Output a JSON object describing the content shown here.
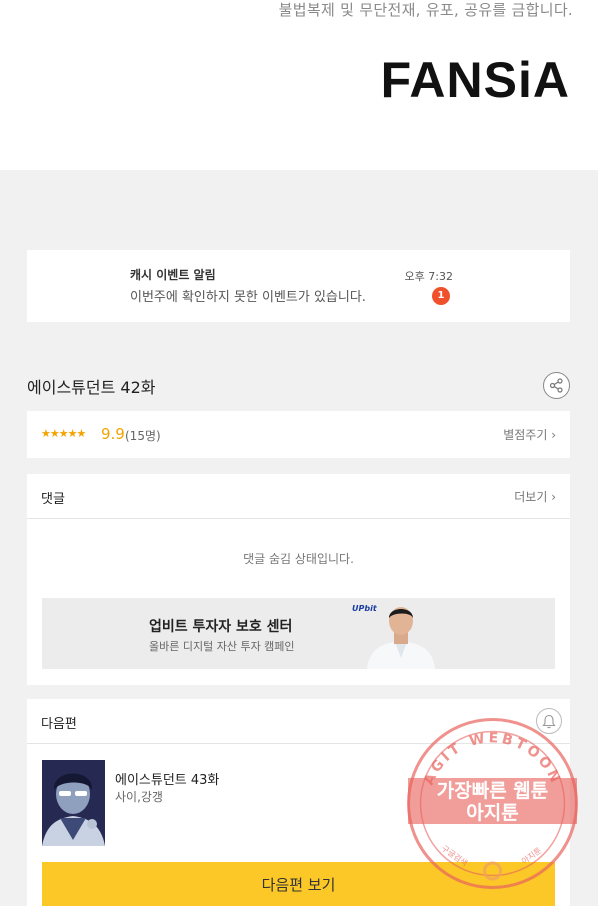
{
  "notice": "불법복제 및 무단전재, 유포, 공유를 금합니다.",
  "brand": {
    "logo": "FANSiA"
  },
  "alert": {
    "title": "캐시 이벤트 알림",
    "body": "이번주에 확인하지 못한 이벤트가 있습니다.",
    "time": "오후 7:32",
    "badge": "1"
  },
  "episode": {
    "title": "에이스튜던트 42화",
    "share_icon": "share-icon"
  },
  "rating": {
    "stars": "★★★★★",
    "score": "9.9",
    "count": "(15명)",
    "rate_link": "별점주기 ›"
  },
  "comments": {
    "title": "댓글",
    "more": "더보기 ›",
    "hidden_message": "댓글 숨김 상태입니다."
  },
  "ad": {
    "title": "업비트 투자자 보호 센터",
    "subtitle": "올바른 디지털 자산 투자 캠페인",
    "brand": "UPbit"
  },
  "next": {
    "title": "다음편",
    "episode": "에이스튜던트 43화",
    "author": "사이,강갱",
    "button": "다음편 보기"
  },
  "watermark": {
    "arc": "AGIT WEBTOON",
    "line1": "가장빠른 웹툰",
    "line2": "아지툰",
    "left_small": "구글검색",
    "right_small": "아지툰"
  },
  "colors": {
    "accent": "#fbc827",
    "star": "#f5a300",
    "badge": "#f0502b",
    "stamp": "#e8625d"
  }
}
